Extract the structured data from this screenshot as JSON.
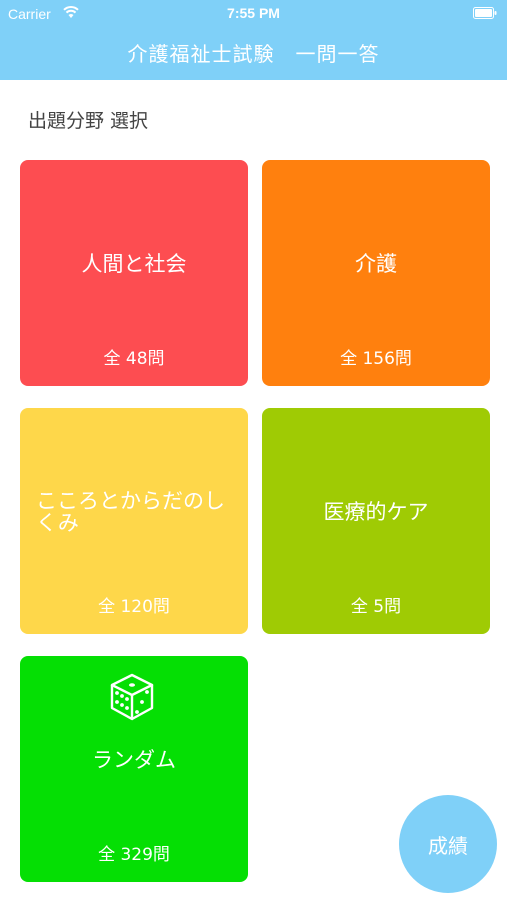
{
  "status_bar": {
    "carrier": "Carrier",
    "time": "7:55 PM"
  },
  "header": {
    "title": "介護福祉士試験　一問一答"
  },
  "section_title": "出題分野 選択",
  "categories": [
    {
      "name": "人間と社会",
      "count": "全 48問",
      "color": "#fd4d51"
    },
    {
      "name": "介護",
      "count": "全 156問",
      "color": "#ff800e"
    },
    {
      "name": "こころとからだのしくみ",
      "count": "全 120問",
      "color": "#fed74a"
    },
    {
      "name": "医療的ケア",
      "count": "全 5問",
      "color": "#9fcb04"
    },
    {
      "name": "ランダム",
      "count": "全 329問",
      "color": "#05df04",
      "icon": "dice-icon"
    }
  ],
  "fab": {
    "label": "成績",
    "color": "#7fd0f8"
  }
}
